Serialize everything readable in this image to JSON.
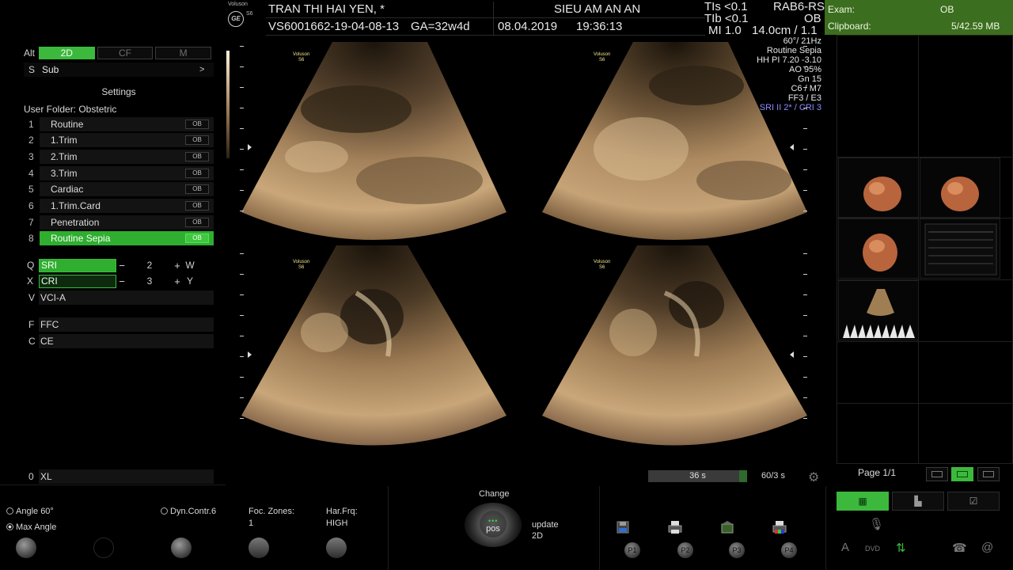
{
  "header": {
    "brand": "Voluson",
    "model": "S6",
    "logo": "GE",
    "patient": "TRAN THI HAI YEN,   *",
    "patient_id": "VS6001662-19-04-08-13",
    "ga": "GA=32w4d",
    "study": "SIEU AM AN AN",
    "date": "08.04.2019",
    "time": "19:36:13",
    "tis": "TIs <0.1",
    "tib": "TIb <0.1",
    "mi": "MI  1.0",
    "probe": "RAB6-RS",
    "app": "OB",
    "depth": "14.0cm / 1.1"
  },
  "exam": {
    "exam_label": "Exam:",
    "exam_value": "OB",
    "clipboard_label": "Clipboard:",
    "clipboard_value": "5/42.59 MB"
  },
  "image_params": [
    "60°/ 21Hz",
    "Routine Sepia",
    "HH PI 7.20 -3.10",
    "AO 95%",
    "Gn  15",
    "C6 / M7",
    "FF3 / E3"
  ],
  "image_params_accent": "SRI II 2* / CRI 3",
  "left_panel": {
    "alt_key": "Alt",
    "modes": [
      {
        "label": "2D",
        "active": true
      },
      {
        "label": "CF",
        "active": false
      },
      {
        "label": "M",
        "active": false
      }
    ],
    "sub_key": "S",
    "sub_label": "Sub",
    "sub_chevron": ">",
    "settings_title": "Settings",
    "user_folder": "User Folder: Obstetric",
    "presets": [
      {
        "num": "1",
        "label": "Routine",
        "tag": "OB"
      },
      {
        "num": "2",
        "label": "1.Trim",
        "tag": "OB"
      },
      {
        "num": "3",
        "label": "2.Trim",
        "tag": "OB"
      },
      {
        "num": "4",
        "label": "3.Trim",
        "tag": "OB"
      },
      {
        "num": "5",
        "label": "Cardiac",
        "tag": "OB"
      },
      {
        "num": "6",
        "label": "1.Trim.Card",
        "tag": "OB"
      },
      {
        "num": "7",
        "label": "Penetration",
        "tag": "OB"
      },
      {
        "num": "8",
        "label": "Routine Sepia",
        "tag": "OB"
      }
    ],
    "sri": {
      "key": "Q",
      "label": "SRI",
      "minus": "−",
      "value": "2",
      "plus": "+",
      "tail": "W"
    },
    "cri": {
      "key": "X",
      "label": "CRI",
      "minus": "−",
      "value": "3",
      "plus": "+",
      "tail": "Y"
    },
    "vci": {
      "key": "V",
      "label": "VCI-A"
    },
    "ffc": {
      "key": "F",
      "label": "FFC"
    },
    "ce": {
      "key": "C",
      "label": "CE"
    },
    "xl": {
      "key": "0",
      "label": "XL"
    }
  },
  "bottom": {
    "angle": "Angle 60°",
    "max_angle": "Max Angle",
    "dyn_contr": "Dyn.Contr.6",
    "foc_zones_label": "Foc. Zones:",
    "foc_zones_value": "1",
    "har_frq_label": "Har.Frq:",
    "har_frq_value": "HIGH",
    "change": "Change",
    "pos": "pos",
    "update": "update",
    "update_mode": "2D",
    "p_buttons": [
      "P1",
      "P2",
      "P3",
      "P4"
    ],
    "timer": "36 s",
    "rate": "60/3 s",
    "page": "Page 1/1",
    "bottom_glyphs": {
      "a": "A",
      "dvd": "DVD"
    }
  },
  "colors": {
    "accent_green": "#3cb93c",
    "exam_banner": "#3b6e1e",
    "sepia": "#a07e54",
    "accent_param": "#8a8cff"
  }
}
